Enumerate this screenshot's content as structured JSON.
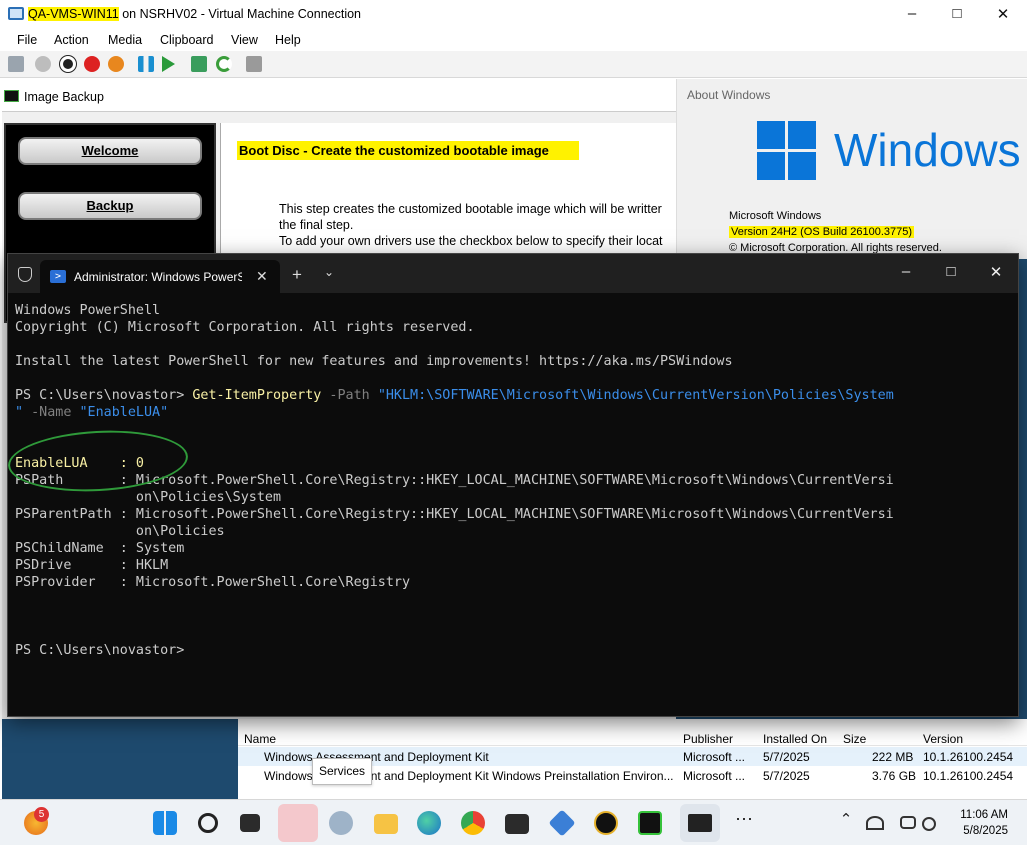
{
  "vm_window": {
    "title_highlight": "QA-VMS-WIN11",
    "title_rest": " on NSRHV02 - Virtual Machine Connection",
    "menu": [
      "File",
      "Action",
      "Media",
      "Clipboard",
      "View",
      "Help"
    ]
  },
  "image_backup": {
    "title": "Image Backup",
    "nav": [
      "Welcome",
      "Backup"
    ],
    "heading": "Boot Disc - Create the customized bootable image",
    "lines": [
      "This step creates the customized bootable image which will be writter",
      "the final step.",
      "To add your own drivers use the checkbox below to specify their locat"
    ]
  },
  "about_windows": {
    "title": "About Windows",
    "wordmark": "Windows",
    "product": "Microsoft Windows",
    "version": "Version 24H2 (OS Build 26100.3775)",
    "copyright": "© Microsoft Corporation. All rights reserved."
  },
  "programs": {
    "columns": [
      "Name",
      "Publisher",
      "Installed On",
      "Size",
      "Version"
    ],
    "rows": [
      {
        "name": "Windows Assessment and Deployment Kit",
        "publisher": "Microsoft ...",
        "installed": "5/7/2025",
        "size": "222 MB",
        "version": "10.1.26100.2454"
      },
      {
        "name": "Windows Assessment and Deployment Kit Windows Preinstallation Environ...",
        "publisher": "Microsoft ...",
        "installed": "5/7/2025",
        "size": "3.76 GB",
        "version": "10.1.26100.2454"
      }
    ],
    "tooltip": "Services"
  },
  "terminal": {
    "tab_title": "Administrator: Windows PowerShell",
    "lines": {
      "l1": "Windows PowerShell",
      "l2": "Copyright (C) Microsoft Corporation. All rights reserved.",
      "l3": "Install the latest PowerShell for new features and improvements! https://aka.ms/PSWindows",
      "prompt": "PS C:\\Users\\novastor> ",
      "cmdlet": "Get-ItemProperty",
      "p_path": " -Path ",
      "path_val": "\"HKLM:\\SOFTWARE\\Microsoft\\Windows\\CurrentVersion\\Policies\\System",
      "path_end": "\"",
      "p_name": " -Name ",
      "name_val": "\"EnableLUA\"",
      "enablelua": "EnableLUA    : 0",
      "pspath": "PSPath       : Microsoft.PowerShell.Core\\Registry::HKEY_LOCAL_MACHINE\\SOFTWARE\\Microsoft\\Windows\\CurrentVersi",
      "pspath2": "               on\\Policies\\System",
      "psparent": "PSParentPath : Microsoft.PowerShell.Core\\Registry::HKEY_LOCAL_MACHINE\\SOFTWARE\\Microsoft\\Windows\\CurrentVersi",
      "psparent2": "               on\\Policies",
      "pschild": "PSChildName  : System",
      "psdrive": "PSDrive      : HKLM",
      "psprovider": "PSProvider   : Microsoft.PowerShell.Core\\Registry",
      "final_prompt": "PS C:\\Users\\novastor>"
    }
  },
  "taskbar": {
    "notification_count": "5",
    "time": "11:06 AM",
    "date": "5/8/2025"
  }
}
